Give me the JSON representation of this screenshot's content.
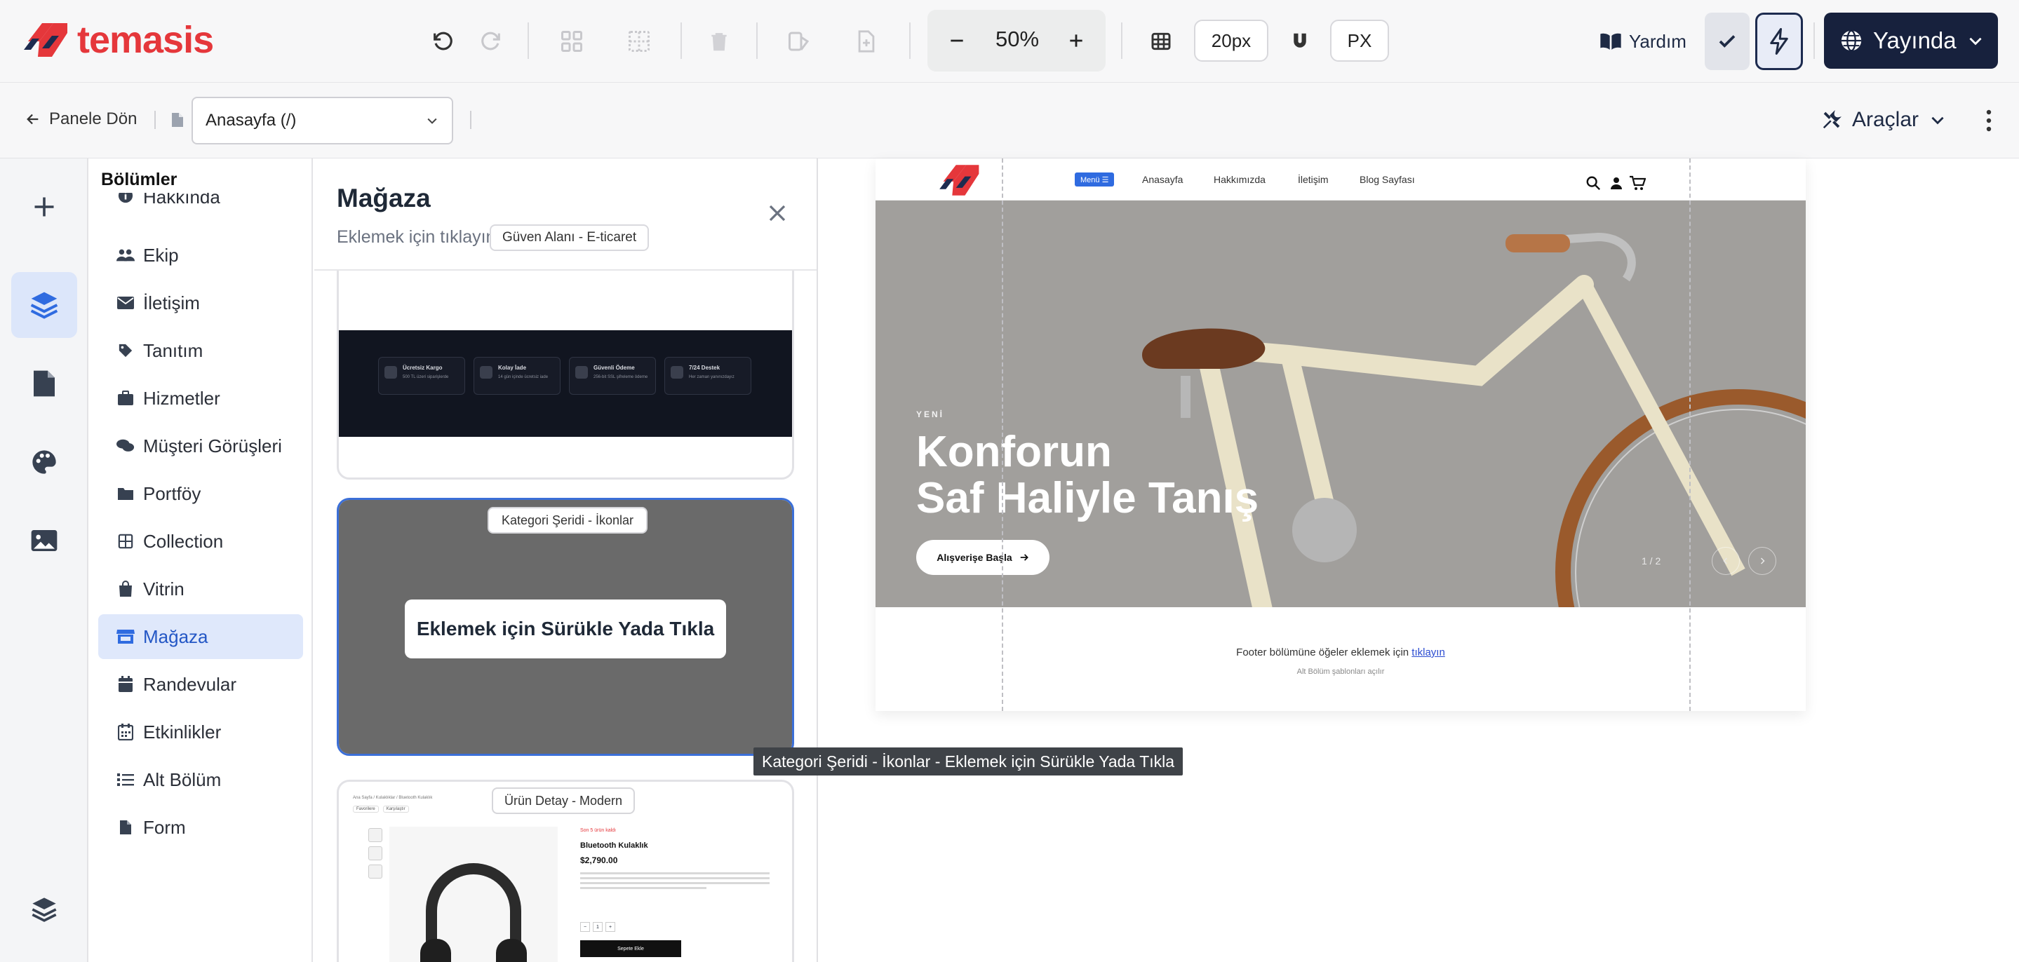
{
  "brand": {
    "name": "temasis",
    "color": "#e5373b"
  },
  "toolbar": {
    "zoom": "50%",
    "grid_size": "20px",
    "unit": "PX",
    "help": "Yardım",
    "publish": "Yayında"
  },
  "subbar": {
    "back": "Panele Dön",
    "page_select": "Anasayfa (/)",
    "tools": "Araçlar"
  },
  "sections": {
    "title": "Bölümler",
    "items": [
      {
        "label": "Hakkında",
        "icon": "info-icon"
      },
      {
        "label": "Ekip",
        "icon": "users-icon"
      },
      {
        "label": "İletişim",
        "icon": "envelope-icon"
      },
      {
        "label": "Tanıtım",
        "icon": "tag-icon"
      },
      {
        "label": "Hizmetler",
        "icon": "briefcase-icon"
      },
      {
        "label": "Müşteri Görüşleri",
        "icon": "comments-icon"
      },
      {
        "label": "Portföy",
        "icon": "folder-icon"
      },
      {
        "label": "Collection",
        "icon": "table-icon"
      },
      {
        "label": "Vitrin",
        "icon": "bag-icon"
      },
      {
        "label": "Mağaza",
        "icon": "store-icon"
      },
      {
        "label": "Randevular",
        "icon": "calendar-icon"
      },
      {
        "label": "Etkinlikler",
        "icon": "calendar-grid-icon"
      },
      {
        "label": "Alt Bölüm",
        "icon": "list-icon"
      },
      {
        "label": "Form",
        "icon": "file-icon"
      }
    ],
    "active": "Mağaza"
  },
  "store_panel": {
    "title": "Mağaza",
    "subtitle": "Eklemek için tıklayın",
    "chip": "Güven Alanı - E-ticaret",
    "trust_items": [
      {
        "title": "Ücretsiz Kargo",
        "sub": "500 TL üzeri siparişlerde"
      },
      {
        "title": "Kolay İade",
        "sub": "14 gün içinde ücretsiz iade"
      },
      {
        "title": "Güvenli Ödeme",
        "sub": "256-bit SSL şifreleme ödeme"
      },
      {
        "title": "7/24 Destek",
        "sub": "Her zaman yanınızdayız"
      }
    ],
    "card2_label": "Kategori Şeridi - İkonlar",
    "drag_label": "Eklemek için Sürükle Yada Tıkla",
    "card3_label": "Ürün Detay - Modern",
    "product": {
      "crumb": "Ana Sayfa / Kulaklıklar / Bluetooth Kulaklık",
      "tags": [
        "Favorilere",
        "Karşılaştır"
      ],
      "stock": "Son 5 ürün kaldı",
      "name": "Bluetooth Kulaklık",
      "price": "$2,790.00",
      "qty": "1",
      "cart": "Sepete Ekle"
    }
  },
  "tooltip": "Kategori Şeridi - İkonlar - Eklemek için Sürükle Yada Tıkla",
  "preview": {
    "nav": {
      "menu_badge": "Menü ☰",
      "links": [
        "Anasayfa",
        "Hakkımızda",
        "İletişim",
        "Blog Sayfası"
      ]
    },
    "hero": {
      "kicker": "YENİ",
      "title_line1": "Konforun",
      "title_line2": "Saf Haliyle Tanış",
      "cta": "Alışverişe Başla",
      "pager": "1 / 2"
    },
    "footer": {
      "message": "Footer bölümüne öğeler eklemek için",
      "link": "tıklayın",
      "sub": "Alt Bölüm şablonları açılır"
    }
  }
}
